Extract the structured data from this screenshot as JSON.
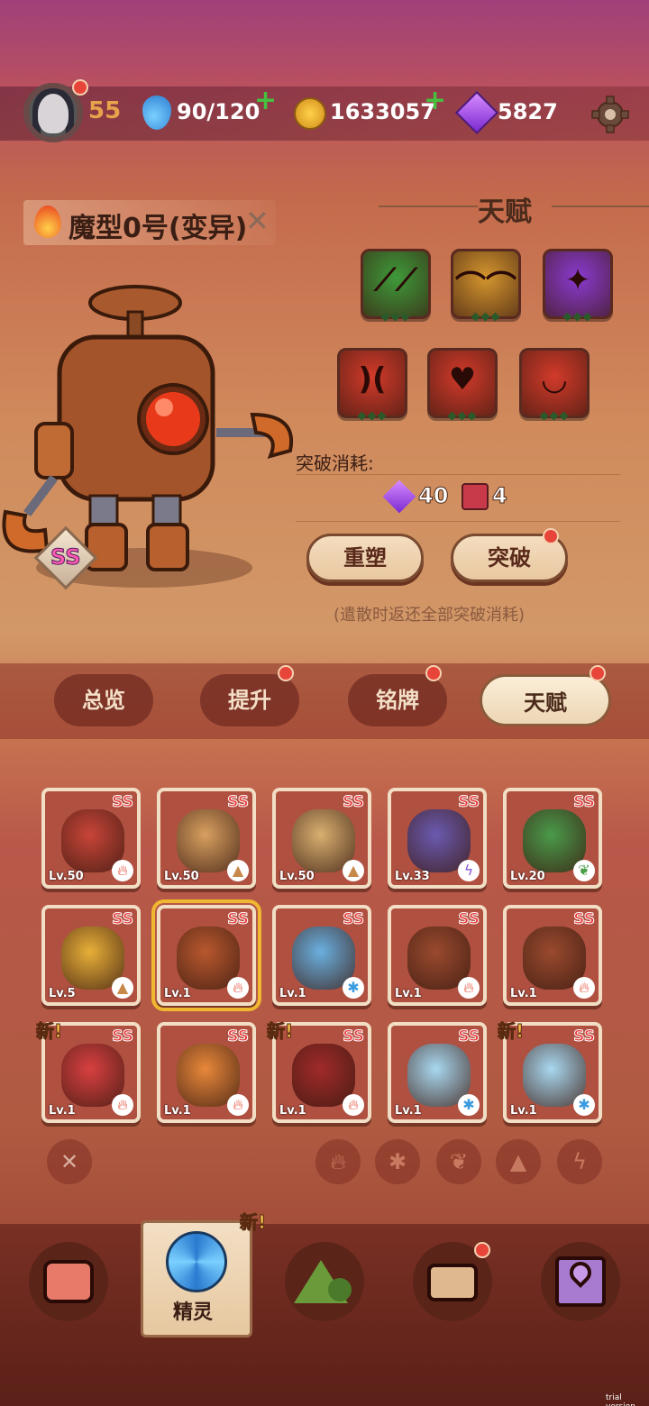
{
  "header": {
    "player_level": "55",
    "stamina": "90/120",
    "coins": "1633057",
    "gems": "5827"
  },
  "pet": {
    "name": "魔型0号(变异)",
    "rank": "SS"
  },
  "talent": {
    "title": "天赋",
    "tiles": [
      {
        "icon": "claw-icon",
        "color": "#3e9a3a",
        "dots": "◆◆◆"
      },
      {
        "icon": "wings-icon",
        "color": "#d4962e",
        "dots": "◆◆◆"
      },
      {
        "icon": "sparkle-icon",
        "color": "#8a3ad0",
        "dots": "◆◆◆"
      },
      {
        "icon": "crescent-icon",
        "color": "#d23a2a",
        "dots": "◆◆◆"
      },
      {
        "icon": "heart-broken-icon",
        "color": "#d23a2a",
        "dots": "◆◆◆"
      },
      {
        "icon": "fangs-icon",
        "color": "#d23a2a",
        "dots": "◆◆◆"
      }
    ],
    "cost_label": "突破消耗:",
    "cost_gem": "40",
    "cost_book": "4",
    "reshape_label": "重塑",
    "breakthrough_label": "突破",
    "note": "(遣散时返还全部突破消耗)"
  },
  "tabs": {
    "overview": "总览",
    "upgrade": "提升",
    "plate": "铭牌",
    "talent": "天赋"
  },
  "pets": [
    {
      "lv": "Lv.50",
      "rank": "SS",
      "el": "fire",
      "color": "#c84438",
      "new": false
    },
    {
      "lv": "Lv.50",
      "rank": "SS",
      "el": "earth",
      "color": "#d8a060",
      "new": false
    },
    {
      "lv": "Lv.50",
      "rank": "SS",
      "el": "earth",
      "color": "#d8b070",
      "new": false
    },
    {
      "lv": "Lv.33",
      "rank": "SS",
      "el": "thunder",
      "color": "#6a5ab0",
      "new": false
    },
    {
      "lv": "Lv.20",
      "rank": "SS",
      "el": "grass",
      "color": "#4a9a4a",
      "new": false
    },
    {
      "lv": "Lv.5",
      "rank": "SS",
      "el": "earth",
      "color": "#e8b038",
      "new": false
    },
    {
      "lv": "Lv.1",
      "rank": "SS",
      "el": "fire",
      "color": "#b8582e",
      "new": false
    },
    {
      "lv": "Lv.1",
      "rank": "SS",
      "el": "ice",
      "color": "#6ab0e0",
      "new": false
    },
    {
      "lv": "Lv.1",
      "rank": "SS",
      "el": "fire",
      "color": "#9a4a2e",
      "new": false
    },
    {
      "lv": "Lv.1",
      "rank": "SS",
      "el": "fire",
      "color": "#9a4a2e",
      "new": false
    },
    {
      "lv": "Lv.1",
      "rank": "SS",
      "el": "fire",
      "color": "#d84040",
      "new": true
    },
    {
      "lv": "Lv.1",
      "rank": "SS",
      "el": "fire",
      "color": "#e8883a",
      "new": false
    },
    {
      "lv": "Lv.1",
      "rank": "SS",
      "el": "fire",
      "color": "#a02a2a",
      "new": true
    },
    {
      "lv": "Lv.1",
      "rank": "SS",
      "el": "ice",
      "color": "#a8d8f0",
      "new": false
    },
    {
      "lv": "Lv.1",
      "rank": "SS",
      "el": "ice",
      "color": "#a8d8f0",
      "new": true
    }
  ],
  "new_badge": "新!",
  "nav": {
    "active_label": "精灵",
    "active_badge": "新!"
  },
  "watermark": "trial version"
}
